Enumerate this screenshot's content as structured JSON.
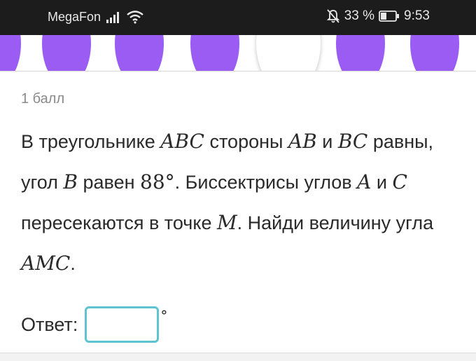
{
  "status_bar": {
    "carrier": "MegaFon",
    "battery": "33 %",
    "time": "9:53",
    "icons": [
      "signal-icon",
      "wifi-icon",
      "mute-bell-icon",
      "battery-icon"
    ]
  },
  "steps": {
    "current_index": 4,
    "accent_color": "#9b5cf3"
  },
  "task": {
    "points": "1 балл",
    "q_p1": "В треугольнике ",
    "q_m1": "ABC",
    "q_p2": " стороны ",
    "q_m2": "AB",
    "q_p3": " и ",
    "q_m3": "BC",
    "q_p4": " равны, угол ",
    "q_m4": "B",
    "q_p5": " равен ",
    "q_m5": "88°",
    "q_p6": ". Биссектрисы углов ",
    "q_m6": "A",
    "q_p7": " и ",
    "q_m7": "C",
    "q_p8": " пересекаются в точке ",
    "q_m8": "M",
    "q_p9": ". Найди величину угла ",
    "q_m9": "AMC",
    "q_p10": "."
  },
  "answer": {
    "label": "Ответ:",
    "value": "",
    "unit": "°",
    "border_color": "#5fc3d0"
  }
}
